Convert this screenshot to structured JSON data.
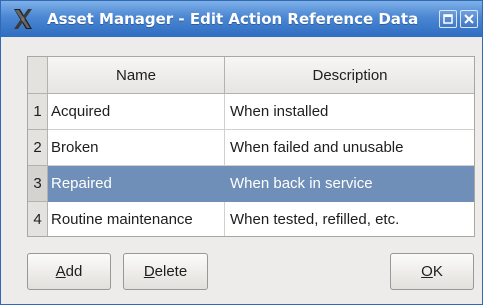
{
  "window": {
    "title": "Asset Manager - Edit Action Reference Data",
    "icons": {
      "app": "x-logo-icon",
      "maximize": "maximize-icon",
      "close": "close-icon"
    }
  },
  "table": {
    "columns": [
      "Name",
      "Description"
    ],
    "rows": [
      {
        "num": "1",
        "name": "Acquired",
        "description": "When installed",
        "selected": false
      },
      {
        "num": "2",
        "name": "Broken",
        "description": "When failed and unusable",
        "selected": false
      },
      {
        "num": "3",
        "name": "Repaired",
        "description": "When back in service",
        "selected": true
      },
      {
        "num": "4",
        "name": "Routine maintenance",
        "description": "When tested, refilled, etc.",
        "selected": false
      }
    ]
  },
  "buttons": {
    "add": {
      "mnemonic": "A",
      "rest": "dd"
    },
    "delete": {
      "mnemonic": "D",
      "rest": "elete"
    },
    "ok": {
      "mnemonic": "O",
      "rest": "K"
    }
  },
  "colors": {
    "titlebar": "#4a86d2",
    "selection": "#6f8fb8"
  }
}
